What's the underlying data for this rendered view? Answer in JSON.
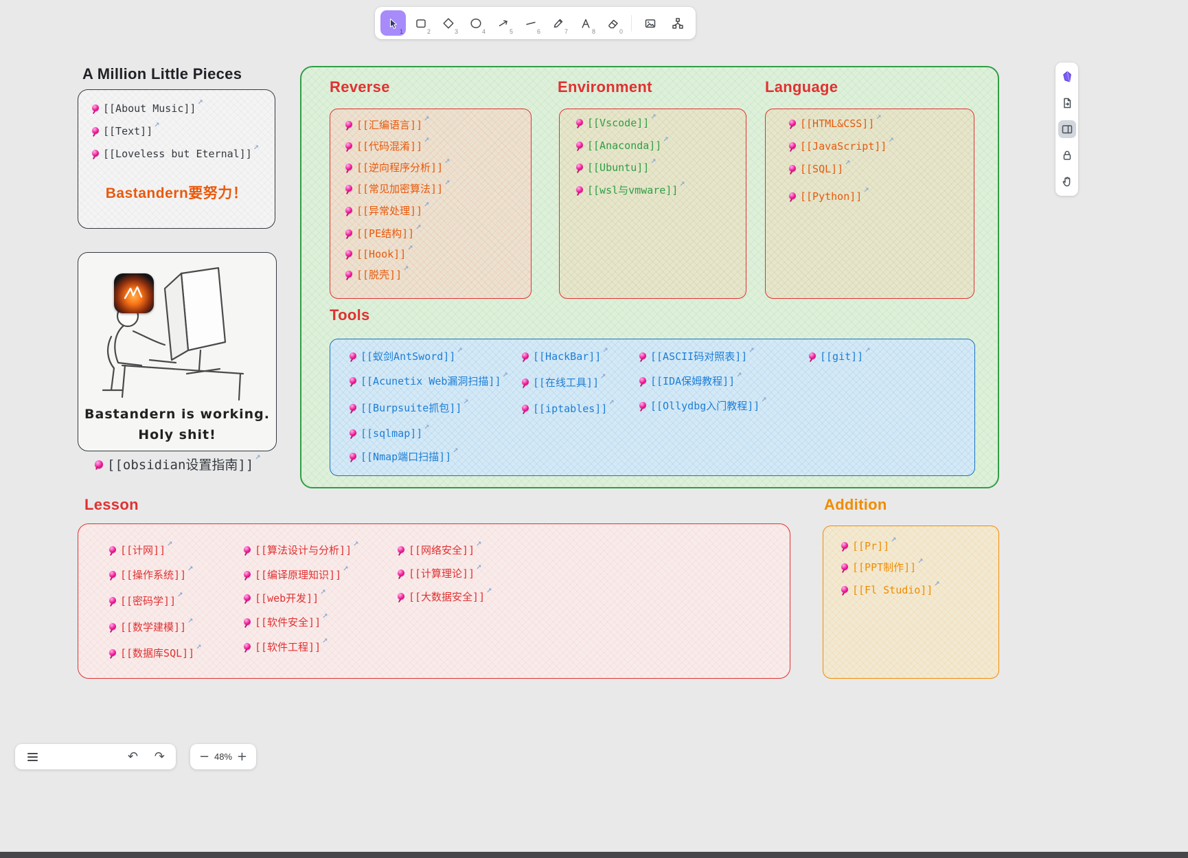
{
  "canvas": {
    "title": "A Million Little Pieces",
    "music_box": {
      "items": [
        "[[About Music]]",
        "[[Text]]",
        "[[Loveless but Eternal]]"
      ],
      "motto": "Bastandern要努力！"
    },
    "drawing_box": {
      "caption_line1": "Bastandern is working.",
      "caption_line2": "Holy shit!"
    },
    "obsidian_link": "[[obsidian设置指南]]",
    "groups": {
      "reverse": {
        "title": "Reverse",
        "items": [
          "[[汇编语言]]",
          "[[代码混淆]]",
          "[[逆向程序分析]]",
          "[[常见加密算法]]",
          "[[异常处理]]",
          "[[PE结构]]",
          "[[Hook]]",
          "[[脱壳]]"
        ]
      },
      "environment": {
        "title": "Environment",
        "items": [
          "[[Vscode]]",
          "[[Anaconda]]",
          "[[Ubuntu]]",
          "[[wsl与vmware]]"
        ]
      },
      "language": {
        "title": "Language",
        "items": [
          "[[HTML&CSS]]",
          "[[JavaScript]]",
          "[[SQL]]",
          "[[Python]]"
        ]
      },
      "tools": {
        "title": "Tools",
        "col1": [
          "[[蚁剑AntSword]]",
          "[[Acunetix Web漏洞扫描]]",
          "[[Burpsuite抓包]]",
          "[[sqlmap]]",
          "[[Nmap端口扫描]]"
        ],
        "col2": [
          "[[HackBar]]",
          "[[在线工具]]",
          "[[iptables]]"
        ],
        "col3": [
          "[[ASCII码对照表]]",
          "[[IDA保姆教程]]",
          "[[Ollydbg入门教程]]"
        ],
        "col4": [
          "[[git]]"
        ]
      },
      "lesson": {
        "title": "Lesson",
        "col1": [
          "[[计网]]",
          "[[操作系统]]",
          "[[密码学]]",
          "[[数学建模]]",
          "[[数据库SQL]]"
        ],
        "col2": [
          "[[算法设计与分析]]",
          "[[编译原理知识]]",
          "[[web开发]]",
          "[[软件安全]]",
          "[[软件工程]]"
        ],
        "col3": [
          "[[网络安全]]",
          "[[计算理论]]",
          "[[大数据安全]]"
        ]
      },
      "addition": {
        "title": "Addition",
        "items": [
          "[[Pr]]",
          "[[PPT制作]]",
          "[[Fl Studio]]"
        ]
      }
    }
  },
  "top_toolbar": {
    "keys": [
      "1",
      "2",
      "3",
      "4",
      "5",
      "6",
      "7",
      "8",
      "0"
    ]
  },
  "footer": {
    "zoom": "48%"
  },
  "icons": {
    "external_link": "↗",
    "undo": "↶",
    "redo": "↷",
    "zoom_out": "−",
    "zoom_in": "+"
  },
  "colors": {
    "active_tool_bg": "#a78bfa",
    "pin_magenta": "#ec1390",
    "heading_red": "#e03131",
    "heading_orange": "#f08c00",
    "link_dark": "#343a40",
    "link_rust": "#e8590c",
    "link_green": "#2f9e44",
    "link_blue": "#1c7ed6",
    "link_red": "#e03131",
    "link_orange": "#f08c00",
    "group_green_border": "#2f9e44",
    "red_border": "#e03131",
    "blue_border": "#1971c2",
    "orange_border": "#f08c00",
    "motto_orange": "#e8590c"
  }
}
